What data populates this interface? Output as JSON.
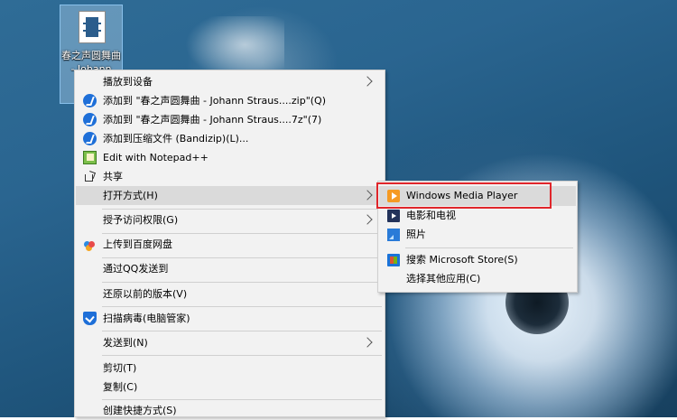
{
  "desktop_icon": {
    "label": "春之声圆舞曲 - Johann"
  },
  "context_menu": {
    "items": [
      {
        "label": "播放到设备"
      },
      {
        "label": "添加到 \"春之声圆舞曲 - Johann Straus....zip\"(Q)"
      },
      {
        "label": "添加到 \"春之声圆舞曲 - Johann Straus....7z\"(7)"
      },
      {
        "label": "添加到压缩文件 (Bandizip)(L)..."
      },
      {
        "label": "Edit with Notepad++"
      },
      {
        "label": "共享"
      },
      {
        "label": "打开方式(H)"
      },
      {
        "label": "授予访问权限(G)"
      },
      {
        "label": "上传到百度网盘"
      },
      {
        "label": "通过QQ发送到"
      },
      {
        "label": "还原以前的版本(V)"
      },
      {
        "label": "扫描病毒(电脑管家)"
      },
      {
        "label": "发送到(N)"
      },
      {
        "label": "剪切(T)"
      },
      {
        "label": "复制(C)"
      },
      {
        "label": "创建快捷方式(S)"
      }
    ]
  },
  "open_with_submenu": {
    "items": [
      {
        "label": "Windows Media Player"
      },
      {
        "label": "电影和电视"
      },
      {
        "label": "照片"
      },
      {
        "label": "搜索 Microsoft Store(S)"
      },
      {
        "label": "选择其他应用(C)"
      }
    ]
  },
  "colors": {
    "menu_bg": "#f2f2f2",
    "hover_bg": "#dadada",
    "highlight_box": "#e0262b"
  }
}
